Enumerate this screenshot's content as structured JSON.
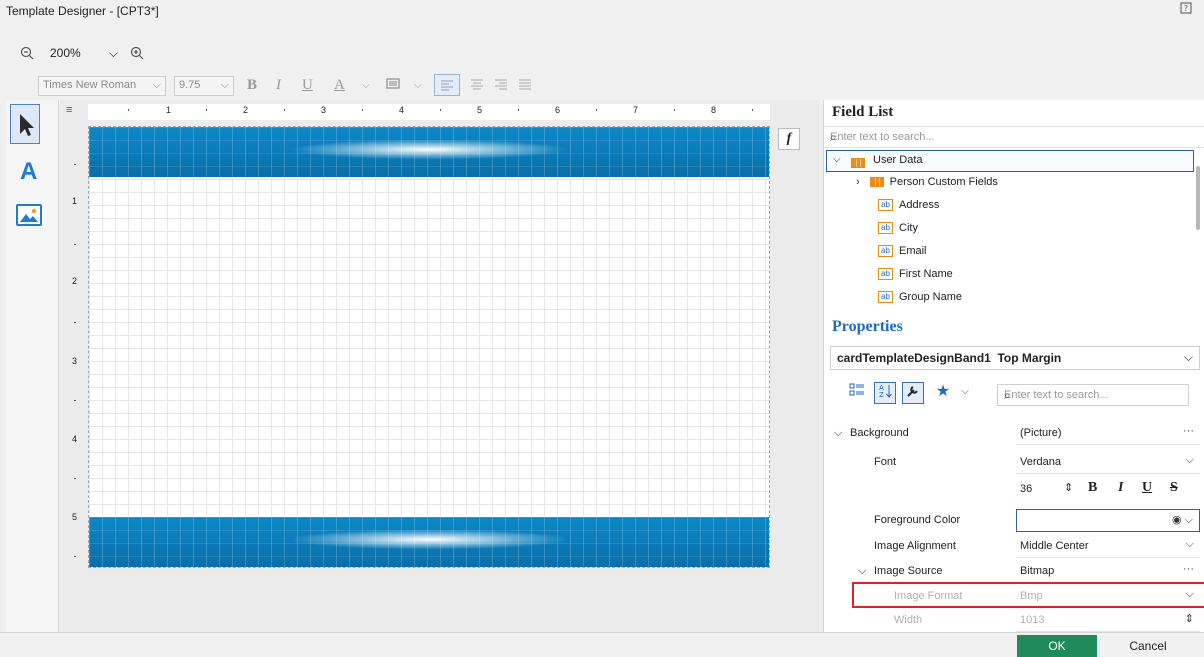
{
  "window": {
    "title": "Template Designer - [CPT3*]",
    "help_icon": "help-icon"
  },
  "zoom": {
    "value": "200%",
    "zoom_out_icon": "zoom-out-icon",
    "zoom_in_icon": "zoom-in-icon"
  },
  "format_toolbar": {
    "font": "Times New Roman",
    "size": "9.75",
    "bold": "B",
    "italic": "I",
    "underline": "U",
    "font_color": "A"
  },
  "toolbox": {
    "items": [
      "pointer-tool",
      "text-tool",
      "picture-tool"
    ],
    "text_tool_label": "A"
  },
  "ruler": {
    "horizontal": [
      "1",
      "2",
      "3",
      "4",
      "5",
      "6",
      "7",
      "8"
    ],
    "vertical": [
      "1",
      "2",
      "3",
      "4",
      "5"
    ],
    "corner": "≡"
  },
  "canvas": {
    "fx_label": "f"
  },
  "field_list": {
    "title": "Field List",
    "search_placeholder": "Enter text to search...",
    "root": "User Data",
    "items": [
      "Person Custom Fields",
      "Address",
      "City",
      "Email",
      "First Name",
      "Group Name"
    ]
  },
  "properties": {
    "title": "Properties",
    "object": "cardTemplateDesignBand1  Top Margin",
    "search_placeholder": "Enter text to search...",
    "rows": [
      {
        "name": "Background",
        "value": "(Picture)"
      },
      {
        "name": "Font",
        "value": "Verdana"
      },
      {
        "name": "",
        "value": "36"
      },
      {
        "name": "Foreground Color",
        "value": ""
      },
      {
        "name": "Image Alignment",
        "value": "Middle Center"
      },
      {
        "name": "Image Source",
        "value": "Bitmap"
      },
      {
        "name": "Image Format",
        "value": "Bmp"
      },
      {
        "name": "Width",
        "value": "1013"
      }
    ],
    "font_style_buttons": {
      "b": "B",
      "i": "I",
      "u": "U",
      "s": "S"
    }
  },
  "footer": {
    "ok": "OK",
    "cancel": "Cancel"
  },
  "colors": {
    "accent": "#1e6bb8",
    "band": "#0a79b5",
    "ok_button": "#1f8b5a",
    "highlight": "#d8242f"
  }
}
